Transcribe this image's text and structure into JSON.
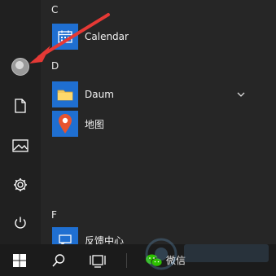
{
  "start_menu": {
    "sections": [
      {
        "letter": "C"
      },
      {
        "letter": "D"
      },
      {
        "letter": "F"
      }
    ],
    "apps": [
      {
        "label": "Calendar",
        "icon": "calendar-icon",
        "color": "#1f6fd1"
      },
      {
        "label": "Daum",
        "icon": "folder-icon",
        "color": "#1f6fd1"
      },
      {
        "label": "地图",
        "icon": "map-pin-icon",
        "color": "#1f6fd1"
      },
      {
        "label": "反馈中心",
        "icon": "feedback-icon",
        "color": "#1f6fd1"
      }
    ],
    "rail": [
      "user-avatar",
      "document-icon",
      "pictures-icon",
      "settings-gear-icon",
      "power-icon"
    ]
  },
  "taskbar": {
    "wechat_label": "微信"
  },
  "colors": {
    "arrow": "#e53935",
    "tile_blue": "#1f6fd1",
    "background": "#262626"
  }
}
